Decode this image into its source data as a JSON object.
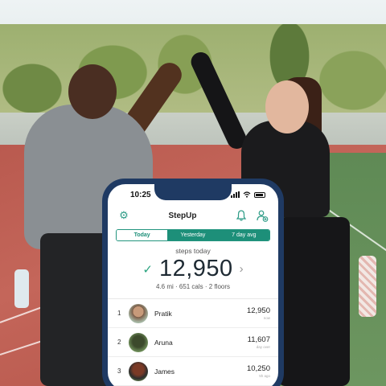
{
  "status_bar": {
    "time": "10:25"
  },
  "app": {
    "title": "StepUp",
    "tabs": [
      {
        "label": "Today",
        "active": true
      },
      {
        "label": "Yesterday",
        "active": false
      },
      {
        "label": "7 day avg",
        "active": false
      }
    ],
    "summary": {
      "label": "steps today",
      "steps": "12,950",
      "details": "4.6 mi · 651 cals · 2 floors"
    },
    "leaderboard": [
      {
        "rank": "1",
        "name": "Pratik",
        "steps": "12,950",
        "sub": "now"
      },
      {
        "rank": "2",
        "name": "Aruna",
        "steps": "11,607",
        "sub": "day over"
      },
      {
        "rank": "3",
        "name": "James",
        "steps": "10,250",
        "sub": "5h ago"
      }
    ]
  },
  "colors": {
    "accent": "#1d8f79",
    "phone_frame": "#1f3a63",
    "check": "#2aa37f"
  },
  "icons": [
    "settings-gear-icon",
    "notification-bell-icon",
    "add-friend-icon",
    "checkmark-icon",
    "chevron-right-icon"
  ]
}
